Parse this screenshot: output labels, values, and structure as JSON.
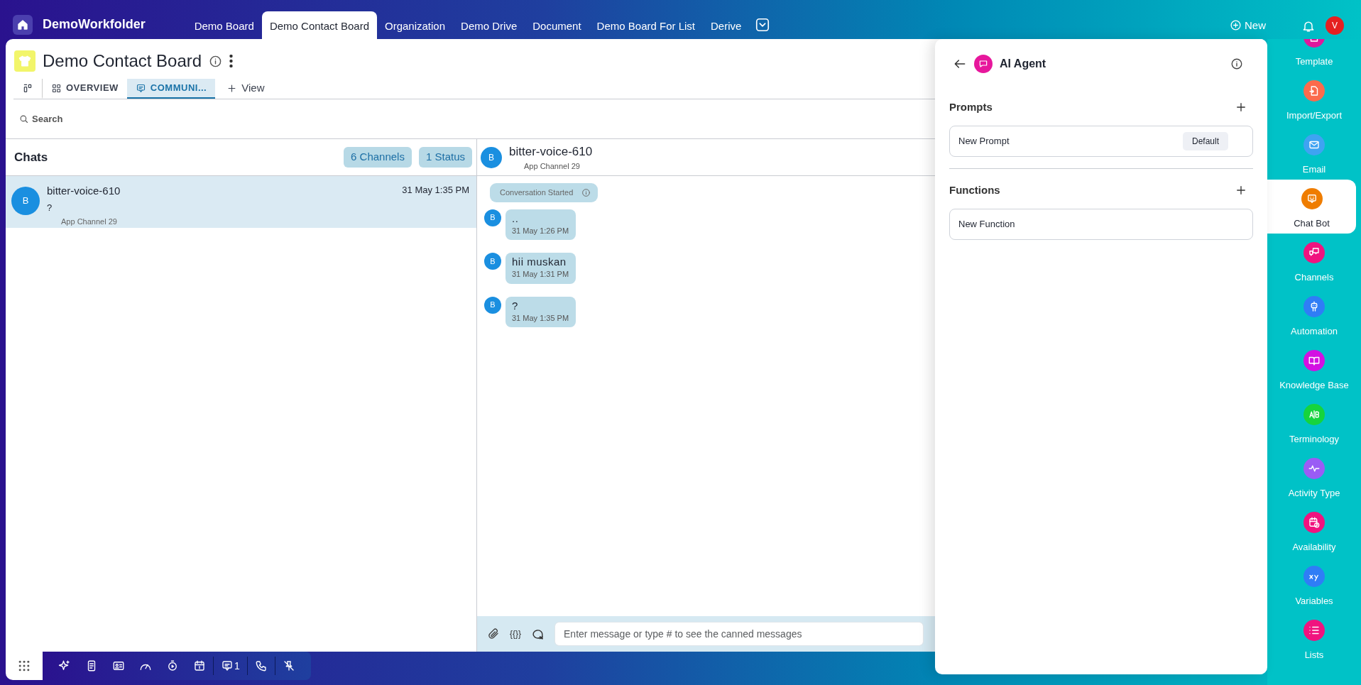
{
  "app": {
    "name": "DemoWorkfolder"
  },
  "top_tabs": [
    {
      "label": "Demo Board",
      "selected": false
    },
    {
      "label": "Demo Contact Board",
      "selected": true
    },
    {
      "label": "Organization",
      "selected": false
    },
    {
      "label": "Demo Drive",
      "selected": false
    },
    {
      "label": "Document",
      "selected": false
    },
    {
      "label": "Demo Board For List",
      "selected": false
    },
    {
      "label": "Derive",
      "selected": false
    }
  ],
  "top_actions": {
    "new_label": "New",
    "avatar": "V"
  },
  "board": {
    "title": "Demo Contact Board",
    "views": [
      {
        "label": "OVERVIEW",
        "selected": false
      },
      {
        "label": "COMMUNI...",
        "selected": true
      }
    ],
    "add_view": "View",
    "search": "Search"
  },
  "chats": {
    "title": "Chats",
    "badges": [
      "6 Channels",
      "1 Status"
    ],
    "items": [
      {
        "avatar": "B",
        "name": "bitter-voice-610",
        "time": "31 May 1:35 PM",
        "preview": "?",
        "channel": "App Channel 29",
        "selected": true
      }
    ]
  },
  "conversation": {
    "avatar": "B",
    "name": "bitter-voice-610",
    "channel": "App Channel 29",
    "event": "Conversation Started",
    "messages": [
      {
        "avatar": "B",
        "text": "..",
        "time": "31 May 1:26 PM"
      },
      {
        "avatar": "B",
        "text": "hii muskan",
        "time": "31 May 1:31 PM"
      },
      {
        "avatar": "B",
        "text": "?",
        "time": "31 May 1:35 PM"
      }
    ],
    "composer": {
      "variable_button": "{{}}",
      "placeholder": "Enter message or type # to see the canned messages"
    }
  },
  "ai_agent": {
    "title": "AI Agent",
    "sections": [
      {
        "title": "Prompts",
        "items": [
          {
            "label": "New Prompt",
            "badge": "Default"
          }
        ]
      },
      {
        "title": "Functions",
        "items": [
          {
            "label": "New Function"
          }
        ]
      }
    ]
  },
  "sidebar": {
    "items": [
      {
        "label": "Template",
        "color": "#e0189c",
        "selected": false
      },
      {
        "label": "Import/Export",
        "color": "#fb6b4c",
        "selected": false
      },
      {
        "label": "Email",
        "color": "#3ea3f2",
        "selected": false
      },
      {
        "label": "Chat Bot",
        "color": "#ef7d00",
        "selected": true
      },
      {
        "label": "Channels",
        "color": "#f0137f",
        "selected": false
      },
      {
        "label": "Automation",
        "color": "#2f7df6",
        "selected": false
      },
      {
        "label": "Knowledge Base",
        "color": "#d311e2",
        "selected": false
      },
      {
        "label": "Terminology",
        "color": "#16d43d",
        "selected": false
      },
      {
        "label": "Activity Type",
        "color": "#9a5cf5",
        "selected": false
      },
      {
        "label": "Availability",
        "color": "#f0137f",
        "selected": false
      },
      {
        "label": "Variables",
        "color": "#2f7df6",
        "selected": false
      },
      {
        "label": "Lists",
        "color": "#f0137f",
        "selected": false
      }
    ]
  },
  "dock": {
    "chat_count": "1"
  }
}
